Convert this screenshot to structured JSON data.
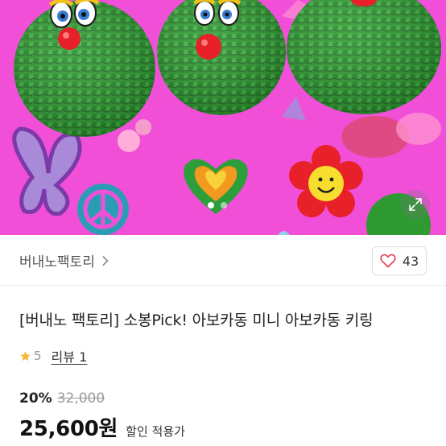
{
  "colors": {
    "hero_background": "#f24fd9",
    "crochet_green": "#2f9a32",
    "nose_red": "#e8202a",
    "text_primary": "#222222",
    "text_muted": "#999999",
    "star": "#f5b73b"
  },
  "hero": {
    "gallery_active_index": 0,
    "gallery_dot_count": 2,
    "expand_icon": "expand-arrows-icon"
  },
  "seller": {
    "name": "버내노팩토리",
    "chevron_icon": "chevron-right-icon"
  },
  "like": {
    "icon": "heart-outline-icon",
    "count": "43"
  },
  "product": {
    "title": "[버내노 팩토리] 소봉Pick! 아보카동 미니 아보카동 키링",
    "rating": "5",
    "review_label": "리뷰 1"
  },
  "price": {
    "discount_rate": "20%",
    "original": "32,000",
    "sale": "25,600원",
    "sale_note": "할인 적용가"
  }
}
